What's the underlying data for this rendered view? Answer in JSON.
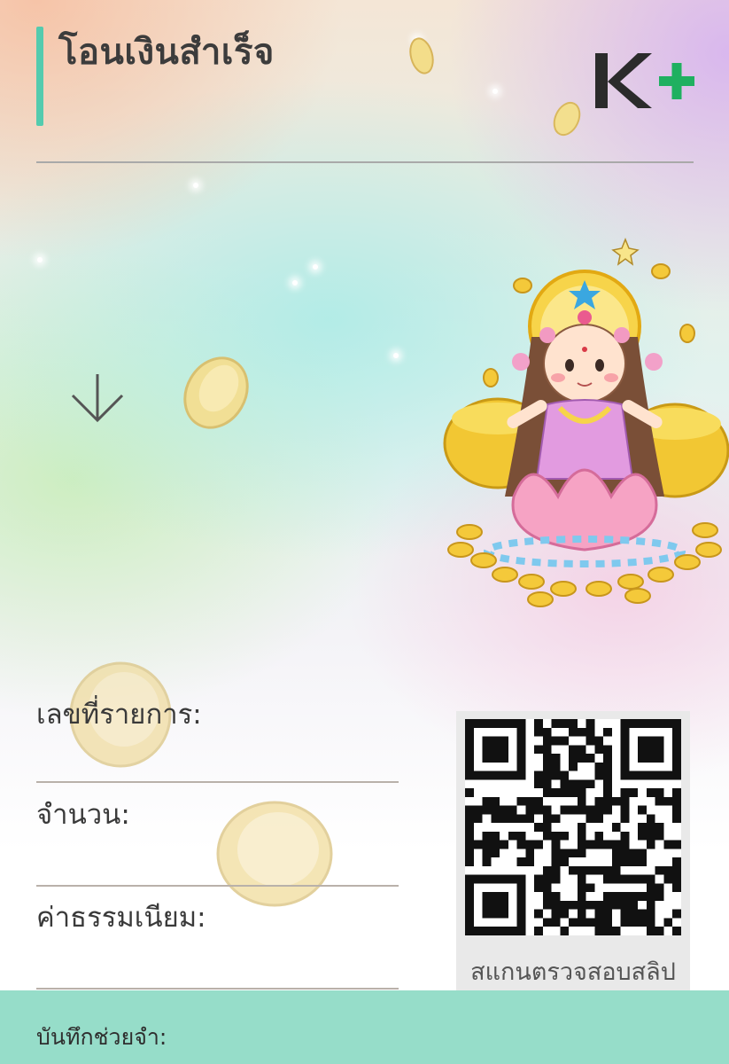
{
  "header": {
    "title": "โอนเงินสำเร็จ",
    "logo_text": "K+",
    "brand_colors": {
      "accent": "#54cbae",
      "logo_dark": "#2b2b2b",
      "logo_plus": "#1fb060"
    }
  },
  "decorations": {
    "arrow_icon": "arrow-down-icon",
    "illustration": "goddess-with-gold-coins",
    "coin_icon": "gold-coin-icon"
  },
  "fields": {
    "transaction_id": {
      "label": "เลขที่รายการ:",
      "value": ""
    },
    "amount": {
      "label": "จำนวน:",
      "value": ""
    },
    "fee": {
      "label": "ค่าธรรมเนียม:",
      "value": ""
    }
  },
  "qr": {
    "caption": "สแกนตรวจสอบสลิป",
    "icon": "qr-code-icon"
  },
  "footer": {
    "memo_label": "บันทึกช่วยจำ:",
    "memo_value": "",
    "background": "#96ddc9"
  }
}
